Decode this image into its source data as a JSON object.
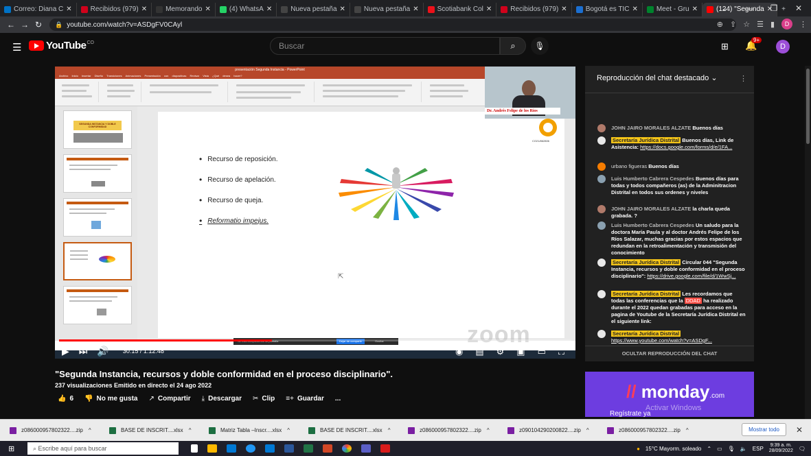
{
  "browser": {
    "tabs": [
      {
        "label": "Correo: Diana C",
        "color": "#0072c6"
      },
      {
        "label": "Recibidos (979)",
        "color": "#d0021b"
      },
      {
        "label": "Memorando",
        "color": "#333333"
      },
      {
        "label": "(4) WhatsA",
        "color": "#25d366"
      },
      {
        "label": "Nueva pestaña",
        "color": "#444444"
      },
      {
        "label": "Nueva pestaña",
        "color": "#444444"
      },
      {
        "label": "Scotiabank Col",
        "color": "#ec111a"
      },
      {
        "label": "Recibidos (979)",
        "color": "#d0021b"
      },
      {
        "label": "Bogotá es TIC",
        "color": "#1b6fd1"
      },
      {
        "label": "Meet - Gru",
        "color": "#00832d"
      },
      {
        "label": "(124) \"Segunda",
        "color": "#ff0000"
      }
    ],
    "new_tab": "+",
    "url": "youtube.com/watch?v=ASDgFV0CAyl"
  },
  "youtube": {
    "logo_text": "YouTube",
    "logo_country": "CO",
    "search_placeholder": "Buscar",
    "notifications_badge": "9+",
    "avatar_letter": "D"
  },
  "video": {
    "ppt_window_title": "presentación Segunda Instancia - PowerPoint",
    "ppt_tabs": "Archivo Inicio Insertar Diseño Transiciones Animaciones Presentación con diapositivas Revisar Vista ¿Qué desea hacer?",
    "thumb1_title": "SEGUNDA INSTANCIA Y DOBLE CONFORMIDAD",
    "bullets": [
      "Recurso de reposición.",
      "Recurso de apelación.",
      "Recurso de queja.",
      "Reformatio impejus."
    ],
    "slide_code": "CO21/862806",
    "presenter_label": "Dr. Andrés Felipe de los Ríos",
    "zoom_watermark": "zoom",
    "share_bar_text": "Se está compartiendo su pantalla",
    "share_stop": "Dejar de compartir",
    "share_hide": "Ocultar",
    "timecode": "30:15 / 1:12:48",
    "progress_fraction": 0.416
  },
  "info": {
    "title": "\"Segunda Instancia, recursos y doble conformidad en el proceso disciplinario\".",
    "meta": "237 visualizaciones  Emitido en directo el 24 ago 2022",
    "likes": "6",
    "dislike": "No me gusta",
    "share": "Compartir",
    "download": "Descargar",
    "clip": "Clip",
    "save": "Guardar",
    "more": "..."
  },
  "chat": {
    "header": "Reproducción del chat destacado",
    "messages": [
      {
        "author": "JOHN JAIRO MORALES ALZATE",
        "text": "Buenos días",
        "mod": false,
        "avatar": "#b07a6a"
      },
      {
        "author": "Secretaría Jurídica Distrital",
        "text": "Buenos días, Link de Asistencia:",
        "link": "https://docs.google.com/forms/d/e/1FA...",
        "mod": true,
        "avatar": "#e8e8e8"
      },
      {
        "author": "urbano figueras",
        "text": "Buenos días",
        "mod": false,
        "avatar": "#f57c00"
      },
      {
        "author": "Luis Humberto Cabrera Cespedes",
        "text": "Buenos días para todas y todos compañeros (as) de la Adminitracion Distrital en todos sus ordenes y niveles",
        "mod": false,
        "avatar": "#8aa0b0"
      },
      {
        "author": "JOHN JAIRO MORALES ALZATE",
        "text": "la charla queda grabada. ?",
        "mod": false,
        "avatar": "#b07a6a"
      },
      {
        "author": "Luis Humberto Cabrera Cespedes",
        "text": "Un saludo para la doctora María Paula y al doctor Andrés Felipe de los Ríos Salazar, muchas gracias por estos espacios que redundan en la retroalimentación y transmisión del conocimiento",
        "mod": false,
        "avatar": "#8aa0b0"
      },
      {
        "author": "Secretaría Jurídica Distrital",
        "text": "Circular 044 \"Segunda Instancia, recursos y doble conformidad en el proceso disciplinario\":",
        "link": "https://drive.google.com/file/d/1WwSj...",
        "mod": true,
        "avatar": "#e8e8e8"
      },
      {
        "author": "Secretaría Jurídica Distrital",
        "text_a": "Les recordamos que todas las conferencias que la",
        "highlight": "DDAD",
        "text_b": "ha realizado durante el 2022 quedan grabadas para acceso en la pagina de Youtube de la Secretaría Jurídica Distrital en el siguiente link:",
        "mod": true,
        "avatar": "#e8e8e8"
      },
      {
        "author": "Secretaría Jurídica Distrital",
        "link": "https://www.youtube.com/watch?v=ASDgF...",
        "mod": true,
        "avatar": "#e8e8e8"
      }
    ],
    "footer": "OCULTAR REPRODUCCIÓN DEL CHAT"
  },
  "ad": {
    "brand": "monday",
    "brand_suffix": ".com",
    "cta": "Regístrate ya",
    "activate_windows": "Activar Windows"
  },
  "downloads": {
    "items": [
      {
        "name": "z086000957802322....zip",
        "color": "#7a1fa2"
      },
      {
        "name": "BASE DE INSCRIT....xlsx",
        "color": "#1d6f42"
      },
      {
        "name": "Matriz Tabla –Inscr....xlsx",
        "color": "#1d6f42"
      },
      {
        "name": "BASE DE INSCRIT....xlsx",
        "color": "#1d6f42"
      },
      {
        "name": "z086000957802322....zip",
        "color": "#7a1fa2"
      },
      {
        "name": "z090104290200822....zip",
        "color": "#7a1fa2"
      },
      {
        "name": "z086000957802322....zip",
        "color": "#7a1fa2"
      }
    ],
    "show_all": "Mostrar todo"
  },
  "taskbar": {
    "search_placeholder": "Escribe aquí para buscar",
    "weather": "15°C  Mayorm. soleado",
    "lang": "ESP",
    "time": "9:39 a. m.",
    "date": "28/09/2022"
  }
}
